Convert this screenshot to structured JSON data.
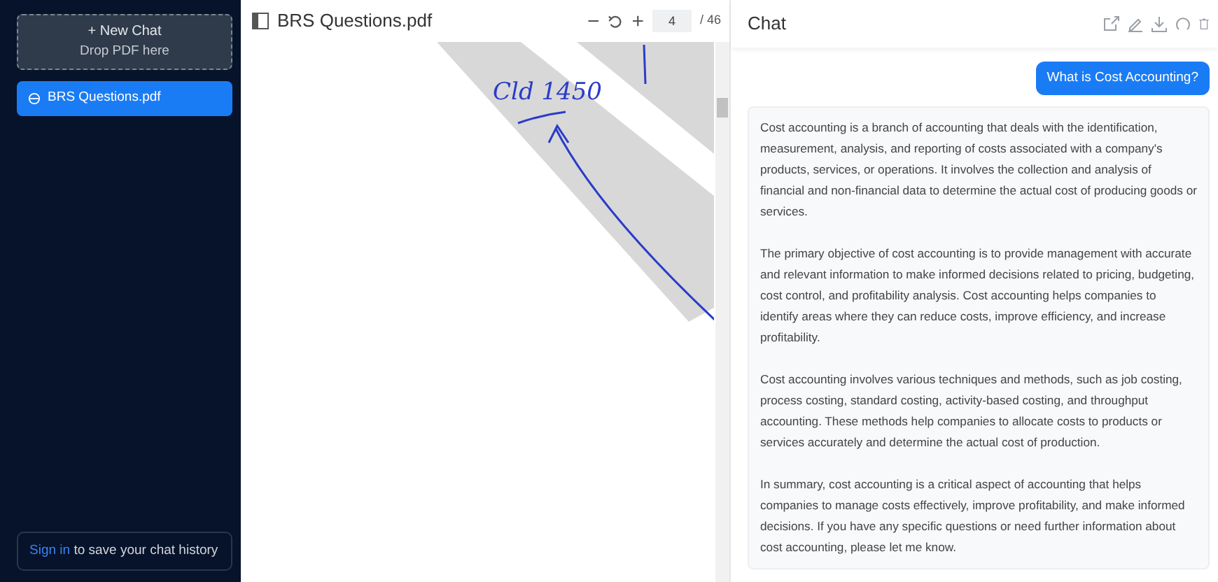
{
  "sidebar": {
    "new_chat": {
      "icon": "+",
      "label": "New Chat",
      "hint": "Drop PDF here"
    },
    "items": [
      {
        "label": "BRS Questions.pdf",
        "selected": true
      }
    ],
    "signin": {
      "link": "Sign in",
      "text": "to save your chat history"
    }
  },
  "pdf": {
    "title": "BRS Questions.pdf",
    "zoom_out": "−",
    "zoom_in": "+",
    "page": "4",
    "total": "/ 46",
    "handwriting": "Cld 1450"
  },
  "chat": {
    "title": "Chat",
    "messages": [
      {
        "kind": "question",
        "text": "What is Cost Accounting?"
      },
      {
        "kind": "answer",
        "paragraphs": [
          "Cost accounting is a branch of accounting that deals with the identification, measurement, analysis, and reporting of costs associated with a company's products, services, or operations. It involves the collection and analysis of financial and non-financial data to determine the actual cost of producing goods or services.",
          "The primary objective of cost accounting is to provide management with accurate and relevant information to make informed decisions related to pricing, budgeting, cost control, and profitability analysis. Cost accounting helps companies to identify areas where they can reduce costs, improve efficiency, and increase profitability.",
          "Cost accounting involves various techniques and methods, such as job costing, process costing, standard costing, activity-based costing, and throughput accounting. These methods help companies to allocate costs to products or services accurately and determine the actual cost of production.",
          "In summary, cost accounting is a critical aspect of accounting that helps companies to manage costs effectively, improve profitability, and make informed decisions. If you have any specific questions or need further information about cost accounting, please let me know."
        ]
      }
    ]
  }
}
